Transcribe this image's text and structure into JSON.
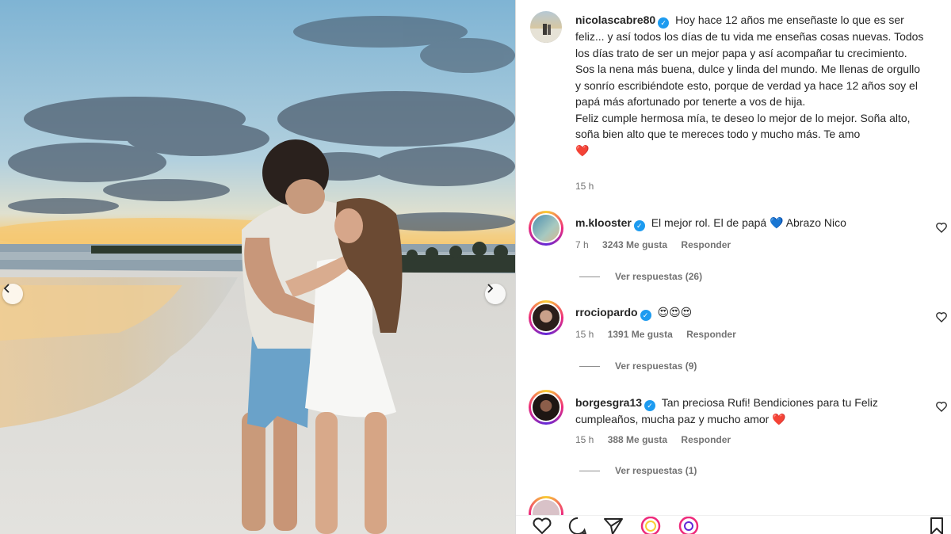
{
  "post": {
    "author": "nicolascabre80",
    "caption_lines": [
      "Hoy hace 12 años me enseñaste lo que es ser feliz... y así todos los días de tu vida me enseñas cosas nuevas. Todos los días trato de ser un mejor papa y así acompañar tu crecimiento. Sos la nena más buena, dulce y linda del mundo. Me llenas de orgullo y sonrío escribiéndote esto, porque de verdad ya hace 12 años soy el papá más afortunado por tenerte a vos de hija.",
      "Feliz cumple hermosa mía, te deseo lo mejor de lo mejor. Soña alto, soña bien alto que te mereces todo y mucho más. Te amo"
    ],
    "caption_emoji": "❤️",
    "time": "15 h"
  },
  "comments": [
    {
      "user": "m.klooster",
      "text": "El mejor rol. El de papá",
      "emoji": "💙",
      "text_after": "Abrazo Nico",
      "time": "7 h",
      "likes": "3243 Me gusta",
      "reply": "Responder",
      "replies": "Ver respuestas (26)"
    },
    {
      "user": "rrociopardo",
      "text": "",
      "emoji": "😍😍😍",
      "text_after": "",
      "time": "15 h",
      "likes": "1391 Me gusta",
      "reply": "Responder",
      "replies": "Ver respuestas (9)"
    },
    {
      "user": "borgesgra13",
      "text": "Tan preciosa Rufi! Bendiciones para tu Feliz cumpleaños, mucha paz y mucho amor",
      "emoji": "❤️",
      "text_after": "",
      "time": "15 h",
      "likes": "388 Me gusta",
      "reply": "Responder",
      "replies": "Ver respuestas (1)"
    }
  ],
  "icons": {
    "carousel_prev": "chevron-left-icon",
    "carousel_next": "chevron-right-icon",
    "comment_like": "heart-outline-icon",
    "actions": [
      "heart-icon",
      "comment-icon",
      "share-icon",
      "reels-icon",
      "instagram-icon",
      "bookmark-icon"
    ]
  },
  "colors": {
    "verified": "#1d9bf0",
    "text": "#262626",
    "muted": "#737373"
  }
}
